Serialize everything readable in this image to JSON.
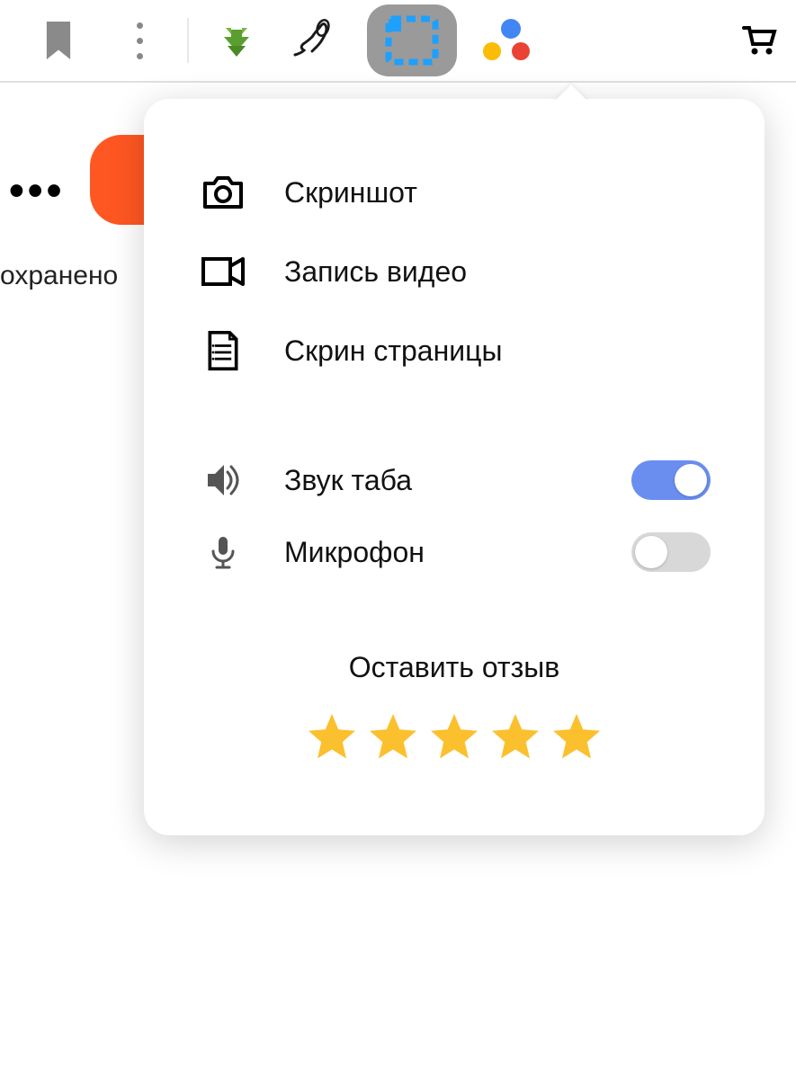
{
  "toolbar": {
    "icons": {
      "bookmark": "bookmark-icon",
      "kebab": "kebab-menu-icon",
      "download": "download-icon",
      "signature": "signature-icon",
      "screenshot_ext": "screenshot-extension-icon",
      "dots_ext": "colored-dots-extension-icon",
      "cart": "cart-icon"
    }
  },
  "background": {
    "dots": "•••",
    "partial_text": "охранено"
  },
  "popup": {
    "items": [
      {
        "icon": "camera-icon",
        "label": "Скриншот"
      },
      {
        "icon": "video-camera-icon",
        "label": "Запись видео"
      },
      {
        "icon": "document-list-icon",
        "label": "Скрин страницы"
      }
    ],
    "toggles": [
      {
        "icon": "speaker-icon",
        "label": "Звук таба",
        "on": true
      },
      {
        "icon": "microphone-icon",
        "label": "Микрофон",
        "on": false
      }
    ],
    "feedback": {
      "title": "Оставить отзыв",
      "stars": 5
    }
  },
  "colors": {
    "toggle_on": "#6a8ef0",
    "toggle_off": "#d8d8d8",
    "star": "#fbc02d",
    "accent_orange": "#ff5722"
  }
}
